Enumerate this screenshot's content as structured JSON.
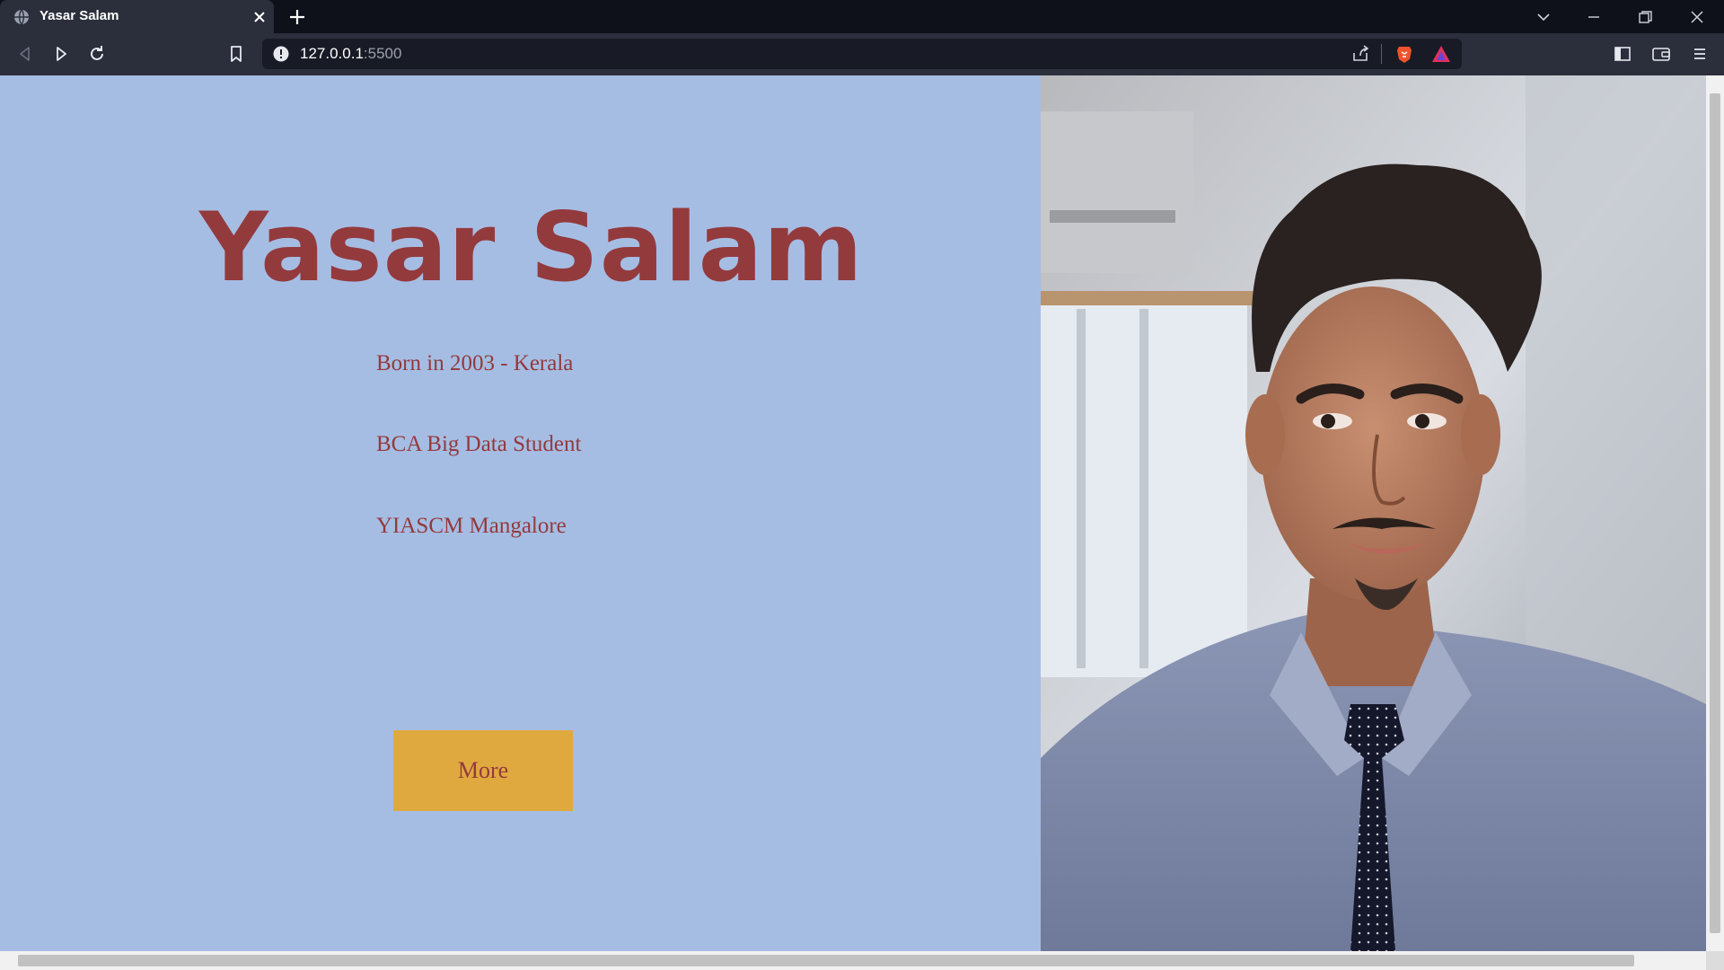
{
  "browser": {
    "tab_title": "Yasar Salam",
    "url_host": "127.0.0.1",
    "url_port": ":5500"
  },
  "page": {
    "name": "Yasar Salam",
    "info": [
      "Born in 2003 - Kerala",
      "BCA Big Data Student",
      "YIASCM Mangalore"
    ],
    "more_label": "More"
  },
  "colors": {
    "page_background": "#a6bde3",
    "heading_text": "#933a3d",
    "button_background": "#e0a93f",
    "chrome_dark": "#0e111a",
    "chrome_toolbar": "#2b2f3c"
  },
  "icons": {
    "tab_favicon": "globe-icon",
    "tab_close": "close-icon",
    "new_tab": "plus-icon",
    "back": "back-icon",
    "forward": "forward-icon",
    "reload": "reload-icon",
    "bookmark": "bookmark-icon",
    "site_info": "info-icon",
    "share": "share-icon",
    "brave_shields": "brave-lion-icon",
    "brave_rewards": "rewards-triangle-icon",
    "sidebar": "sidebar-icon",
    "wallet": "wallet-icon",
    "menu": "hamburger-menu-icon",
    "tab_search": "chevron-down-icon",
    "minimize": "minimize-icon",
    "maximize": "restore-icon",
    "close_window": "close-icon"
  }
}
